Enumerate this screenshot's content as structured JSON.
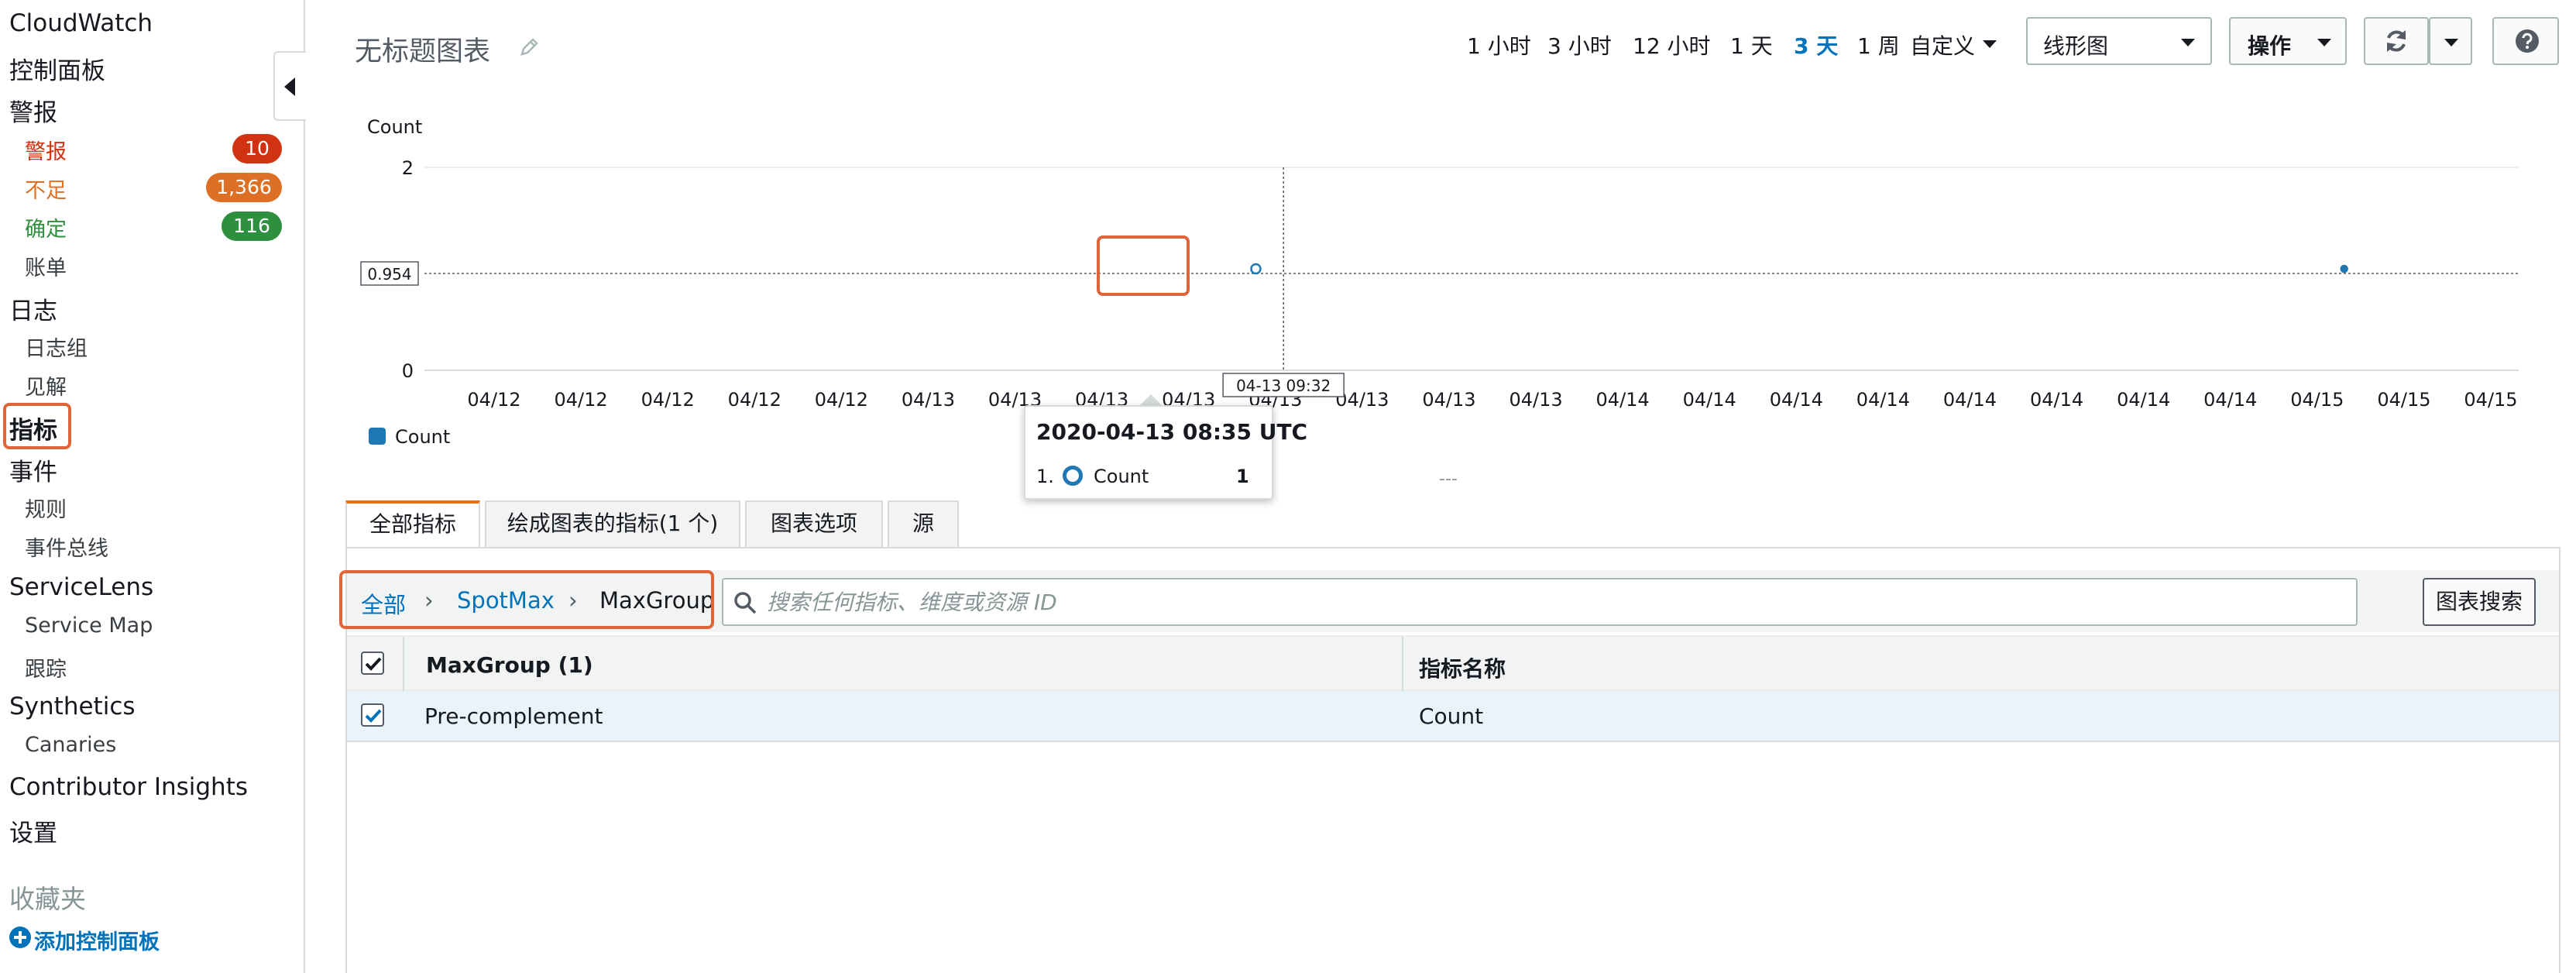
{
  "sidebar": {
    "app_title": "CloudWatch",
    "dashboards": "控制面板",
    "alarms_header": "警报",
    "alarms": [
      {
        "label": "警报",
        "count": "10",
        "color": "#d13212"
      },
      {
        "label": "不足",
        "count": "1,366",
        "color": "#dd7025"
      },
      {
        "label": "确定",
        "count": "116",
        "color": "#2e8f3e"
      }
    ],
    "billing": "账单",
    "logs_header": "日志",
    "log_groups": "日志组",
    "insights": "见解",
    "metrics": "指标",
    "events_header": "事件",
    "rules": "规则",
    "event_buses": "事件总线",
    "servicelens_header": "ServiceLens",
    "service_map": "Service Map",
    "traces": "跟踪",
    "synthetics_header": "Synthetics",
    "canaries": "Canaries",
    "contributor_insights": "Contributor Insights",
    "settings": "设置",
    "favorites_header": "收藏夹",
    "add_dashboard": "添加控制面板"
  },
  "header": {
    "title": "无标题图表",
    "time_ranges": [
      "1 小时",
      "3 小时",
      "12 小时",
      "1 天",
      "3 天",
      "1 周"
    ],
    "active_range": "3 天",
    "custom": "自定义",
    "chart_type": "线形图",
    "actions": "操作"
  },
  "chart_data": {
    "type": "line",
    "ylabel": "Count",
    "y_ticks": [
      "2",
      "0"
    ],
    "ylim": [
      0,
      2
    ],
    "x_tick_labels": [
      "04/12",
      "04/12",
      "04/12",
      "04/12",
      "04/12",
      "04/13",
      "04/13",
      "04/13",
      "04/13",
      "04/13",
      "04/13",
      "04/13",
      "04/13",
      "04/14",
      "04/14",
      "04/14",
      "04/14",
      "04/14",
      "04/14",
      "04/14",
      "04/14",
      "04/15",
      "04/15",
      "04/15"
    ],
    "series": [
      {
        "name": "Count",
        "color": "#1f77b4",
        "points": [
          {
            "t": "2020-04-13 08:35",
            "y": 1
          },
          {
            "t": "2020-04-14 22:00",
            "y": 1
          }
        ]
      }
    ],
    "hover_value": "0.954",
    "hover_time": "04-13 09:32",
    "legend": [
      "Count"
    ],
    "legend_position": "bottom-left"
  },
  "tooltip": {
    "title": "2020-04-13 08:35 UTC",
    "index": "1.",
    "name": "Count",
    "value": "1"
  },
  "tabs": [
    "全部指标",
    "绘成图表的指标(1 个)",
    "图表选项",
    "源"
  ],
  "breadcrumb": [
    "全部",
    "SpotMax",
    "MaxGroup"
  ],
  "search": {
    "placeholder": "搜索任何指标、维度或资源 ID",
    "button": "图表搜索"
  },
  "table": {
    "headers": [
      "MaxGroup (1)",
      "指标名称"
    ],
    "rows": [
      {
        "col1": "Pre-complement",
        "col2": "Count",
        "checked": true
      }
    ]
  },
  "misc": {
    "dash_mark": "---"
  }
}
